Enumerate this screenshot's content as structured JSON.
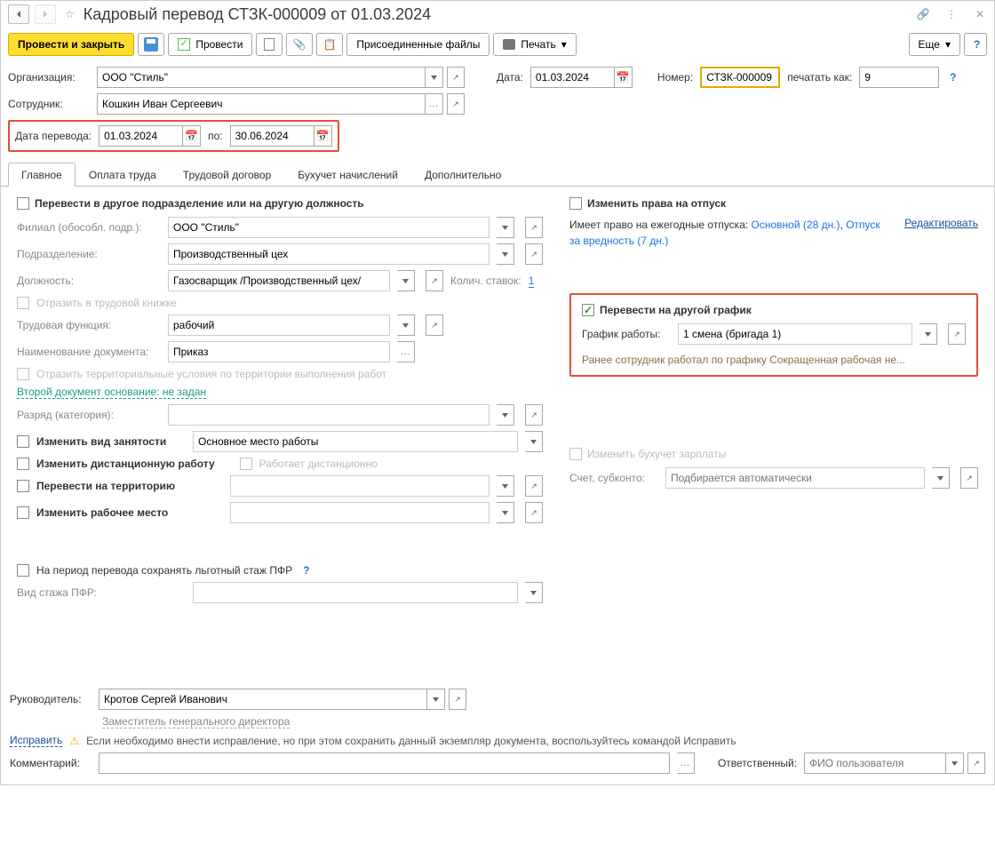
{
  "header": {
    "title": "Кадровый перевод СТЗК-000009 от 01.03.2024"
  },
  "toolbar": {
    "closePost": "Провести и закрыть",
    "post": "Провести",
    "attached": "Присоединенные файлы",
    "print": "Печать",
    "more": "Еще"
  },
  "top": {
    "orgLabel": "Организация:",
    "orgValue": "ООО \"Стиль\"",
    "dateLabel": "Дата:",
    "dateValue": "01.03.2024",
    "numLabel": "Номер:",
    "numValue": "СТЗК-000009",
    "printAsLabel": "печатать как:",
    "printAsValue": "9",
    "empLabel": "Сотрудник:",
    "empValue": "Кошкин Иван Сергеевич",
    "transDateLabel": "Дата перевода:",
    "transDateFrom": "01.03.2024",
    "toLabel": "по:",
    "transDateTo": "30.06.2024"
  },
  "tabs": {
    "main": "Главное",
    "pay": "Оплата труда",
    "contract": "Трудовой договор",
    "acc": "Бухучет начислений",
    "extra": "Дополнительно"
  },
  "left": {
    "chkTransfer": "Перевести в другое подразделение или на другую должность",
    "branchLbl": "Филиал (обособл. подр.):",
    "branchVal": "ООО \"Стиль\"",
    "deptLbl": "Подразделение:",
    "deptVal": "Производственный цех",
    "posLbl": "Должность:",
    "posVal": "Газосварщик /Производственный цех/",
    "ratesLbl": "Колич. ставок:",
    "ratesVal": "1",
    "bookChk": "Отразить в трудовой книжке",
    "funcLbl": "Трудовая функция:",
    "funcVal": "рабочий",
    "docNameLbl": "Наименование документа:",
    "docNameVal": "Приказ",
    "terrChk": "Отразить территориальные условия по территории выполнения работ",
    "secondDoc": "Второй документ основание: не задан",
    "gradeLbl": "Разряд (категория):",
    "chkEmpType": "Изменить вид занятости",
    "empTypeVal": "Основное место работы",
    "chkRemote": "Изменить дистанционную работу",
    "remoteChk": "Работает дистанционно",
    "chkTerr": "Перевести на территорию",
    "chkWorkplace": "Изменить рабочее место",
    "chkPFR": "На период перевода сохранять льготный стаж ПФР",
    "pfrLbl": "Вид стажа ПФР:"
  },
  "right": {
    "chkVacation": "Изменить права на отпуск",
    "vacText1": "Имеет право на ежегодные отпуска: ",
    "vacLink1": "Основной (28 дн.)",
    "vacLink2": "Отпуск за вредность (7 дн.)",
    "editLink": "Редактировать",
    "chkSchedule": "Перевести на другой график",
    "schedLbl": "График работы:",
    "schedVal": "1 смена (бригада 1)",
    "schedNote": "Ранее сотрудник работал по графику Сокращенная рабочая не...",
    "chkAcc": "Изменить бухучет зарплаты",
    "accLbl": "Счет, субконто:",
    "accPlaceholder": "Подбирается автоматически"
  },
  "footer": {
    "headLbl": "Руководитель:",
    "headVal": "Кротов Сергей Иванович",
    "headSub": "Заместитель генерального директора",
    "fix": "Исправить",
    "fixText": "Если необходимо внести исправление, но при этом сохранить данный экземпляр документа, воспользуйтесь командой Исправить",
    "commentLbl": "Комментарий:",
    "respLbl": "Ответственный:",
    "respPlaceholder": "ФИО пользователя"
  }
}
